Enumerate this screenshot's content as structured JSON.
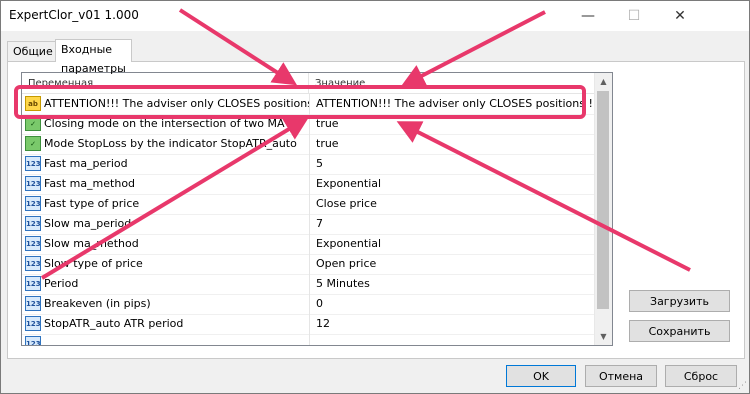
{
  "window": {
    "title": "ExpertClor_v01 1.000",
    "controls": {
      "minimize": "—",
      "maximize": "☐",
      "close": "✕"
    }
  },
  "tabs": [
    {
      "label": "Общие",
      "active": false
    },
    {
      "label": "Входные параметры",
      "active": true
    }
  ],
  "grid": {
    "headers": {
      "variable": "Переменная",
      "value": "Значение"
    },
    "rows": [
      {
        "icon": "text-param-icon",
        "glyph": "ab",
        "name": "ATTENTION!!! The adviser only CLOSES positions !!!",
        "value": "ATTENTION!!! The adviser only CLOSES positions !!!"
      },
      {
        "icon": "bool-param-icon",
        "glyph": "✓",
        "name": "Closing mode on the intersection of two MA",
        "value": "true"
      },
      {
        "icon": "bool-param-icon",
        "glyph": "✓",
        "name": "Mode StopLoss by the indicator StopATR_auto",
        "value": "true"
      },
      {
        "icon": "number-param-icon",
        "glyph": "123",
        "name": "Fast ma_period",
        "value": "5"
      },
      {
        "icon": "number-param-icon",
        "glyph": "123",
        "name": "Fast ma_method",
        "value": "Exponential"
      },
      {
        "icon": "number-param-icon",
        "glyph": "123",
        "name": "Fast type of price",
        "value": "Close price"
      },
      {
        "icon": "number-param-icon",
        "glyph": "123",
        "name": "Slow ma_period",
        "value": "7"
      },
      {
        "icon": "number-param-icon",
        "glyph": "123",
        "name": "Slow ma_method",
        "value": "Exponential"
      },
      {
        "icon": "number-param-icon",
        "glyph": "123",
        "name": "Slow type of price",
        "value": "Open price"
      },
      {
        "icon": "number-param-icon",
        "glyph": "123",
        "name": "Period",
        "value": "5 Minutes"
      },
      {
        "icon": "number-param-icon",
        "glyph": "123",
        "name": "Breakeven (in pips)",
        "value": "0"
      },
      {
        "icon": "number-param-icon",
        "glyph": "123",
        "name": "StopATR_auto ATR period",
        "value": "12"
      },
      {
        "icon": "number-param-icon",
        "glyph": "123",
        "name": "",
        "value": ""
      }
    ]
  },
  "side_buttons": {
    "load": "Загрузить",
    "save": "Сохранить"
  },
  "footer_buttons": {
    "ok": "OK",
    "cancel": "Отмена",
    "reset": "Сброс"
  },
  "scrollbar": {
    "up": "▲",
    "down": "▼"
  },
  "annotation": {
    "color": "#e8386b"
  }
}
